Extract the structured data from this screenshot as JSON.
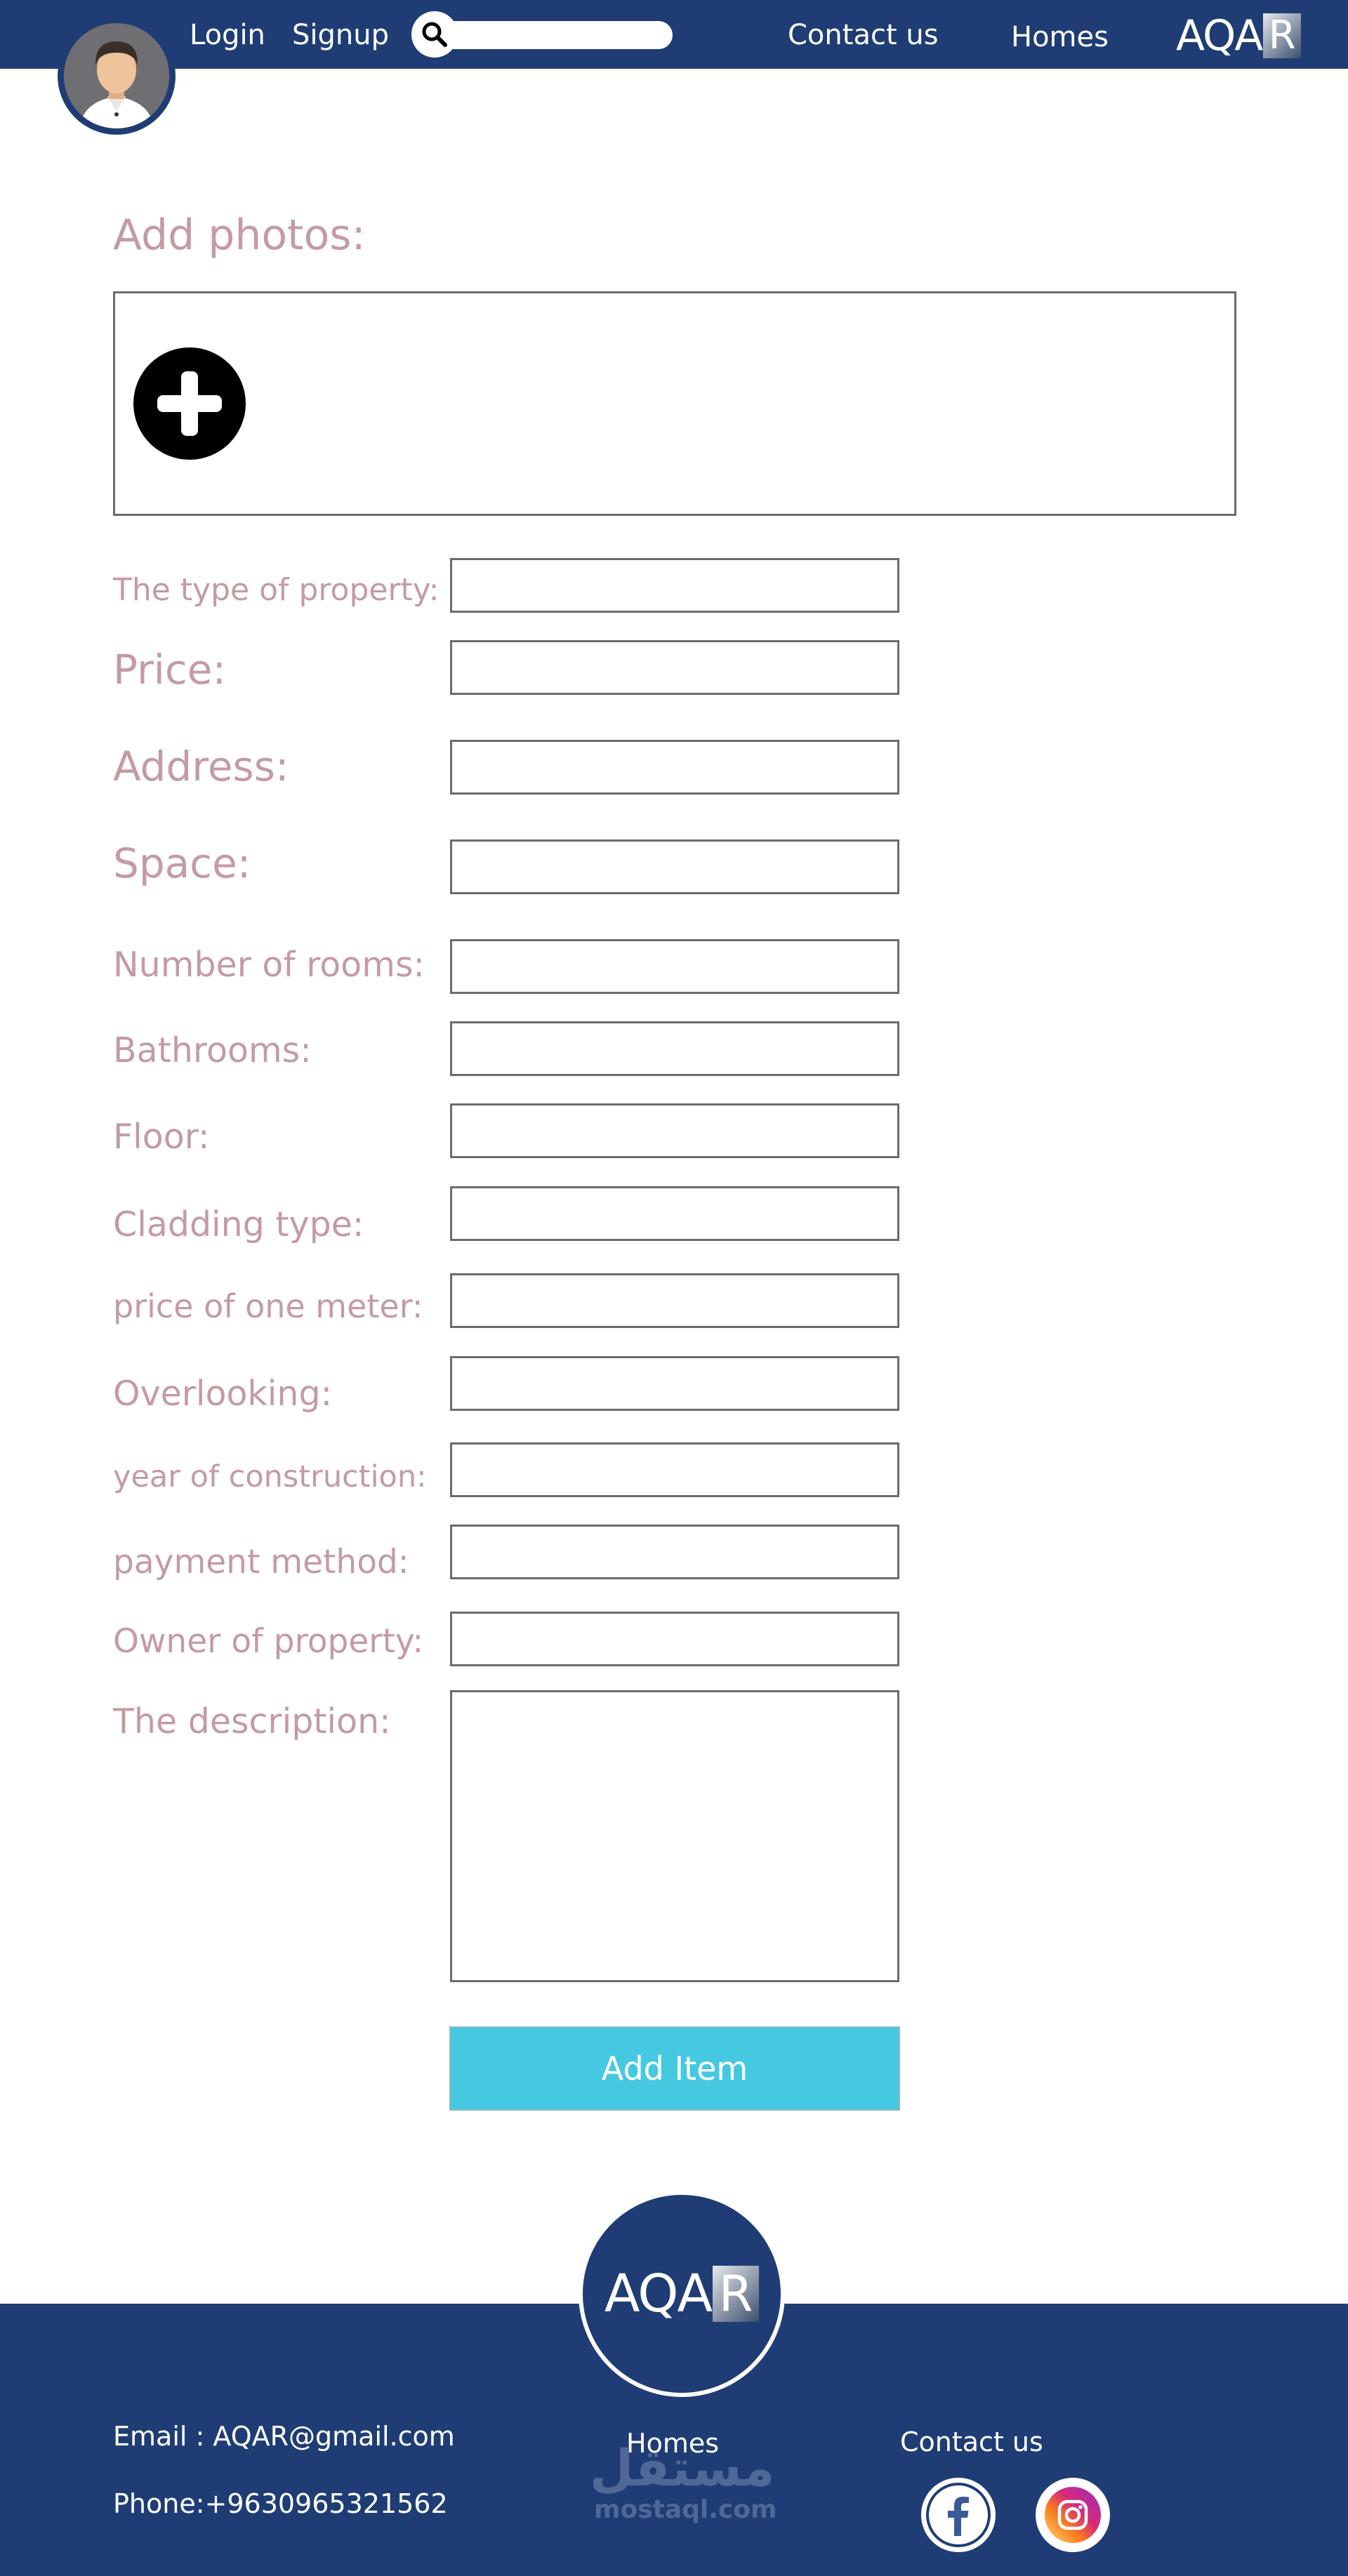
{
  "header": {
    "login": "Login",
    "signup": "Signup",
    "search_value": "",
    "contact": "Contact us",
    "homes": "Homes",
    "brand_main": "AQA",
    "brand_box": "R"
  },
  "form": {
    "add_photos": "Add photos:",
    "fields": {
      "property_type": "The type of property:",
      "price": "Price:",
      "address": "Address:",
      "space": "Space:",
      "rooms": "Number of rooms:",
      "bathrooms": "Bathrooms:",
      "floor": "Floor:",
      "cladding": "Cladding type:",
      "price_meter": "price of one meter:",
      "overlooking": "Overlooking:",
      "year": "year of construction:",
      "payment": "payment method:",
      "owner": "Owner of property:",
      "description": "The description:"
    },
    "submit": "Add Item"
  },
  "footer": {
    "brand_main": "AQA",
    "brand_box": "R",
    "email": "Email : AQAR@gmail.com",
    "phone": "Phone:+9630965321562",
    "homes": "Homes",
    "contact": "Contact us",
    "watermark_ar": "مستقل",
    "watermark_en": "mostaql.com"
  },
  "colors": {
    "navy": "#1f3d74",
    "label_pink": "#c49ba3",
    "button_cyan": "#45c9e0"
  },
  "icons": [
    "avatar",
    "search-icon",
    "plus-circle-icon",
    "facebook-icon",
    "instagram-icon"
  ]
}
